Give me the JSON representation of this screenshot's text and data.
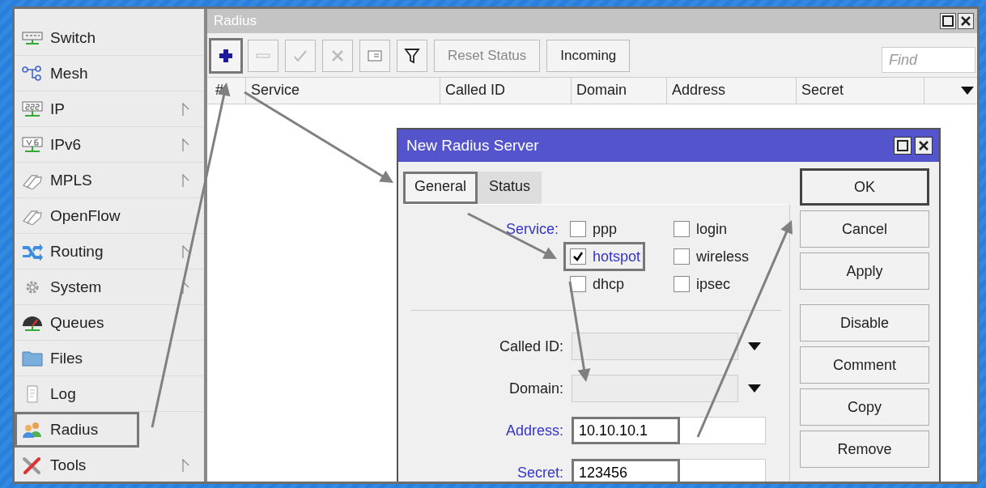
{
  "sidebar": {
    "items": [
      {
        "label": "Switch",
        "submenu": false,
        "highlighted": false
      },
      {
        "label": "Mesh",
        "submenu": false,
        "highlighted": false
      },
      {
        "label": "IP",
        "submenu": true,
        "highlighted": false
      },
      {
        "label": "IPv6",
        "submenu": true,
        "highlighted": false
      },
      {
        "label": "MPLS",
        "submenu": true,
        "highlighted": false
      },
      {
        "label": "OpenFlow",
        "submenu": false,
        "highlighted": false
      },
      {
        "label": "Routing",
        "submenu": true,
        "highlighted": false
      },
      {
        "label": "System",
        "submenu": true,
        "highlighted": false
      },
      {
        "label": "Queues",
        "submenu": false,
        "highlighted": false
      },
      {
        "label": "Files",
        "submenu": false,
        "highlighted": false
      },
      {
        "label": "Log",
        "submenu": false,
        "highlighted": false
      },
      {
        "label": "Radius",
        "submenu": false,
        "highlighted": true
      },
      {
        "label": "Tools",
        "submenu": true,
        "highlighted": false
      }
    ]
  },
  "radius_window": {
    "title": "Radius",
    "toolbar": [
      {
        "kind": "add",
        "disabled": false,
        "highlighted": true
      },
      {
        "kind": "remove",
        "disabled": true,
        "highlighted": false
      },
      {
        "kind": "enable",
        "disabled": true,
        "highlighted": false
      },
      {
        "kind": "disable",
        "disabled": true,
        "highlighted": false
      },
      {
        "kind": "comment",
        "disabled": false,
        "highlighted": false
      },
      {
        "kind": "filter",
        "disabled": false,
        "highlighted": false
      },
      {
        "kind": "text",
        "label": "Reset Status",
        "disabled": true,
        "highlighted": false
      },
      {
        "kind": "text",
        "label": "Incoming",
        "disabled": false,
        "highlighted": false
      }
    ],
    "find": {
      "placeholder": "Find"
    },
    "table": {
      "columns": [
        "#",
        "Service",
        "Called ID",
        "Domain",
        "Address",
        "Secret"
      ]
    }
  },
  "dialog": {
    "title": "New Radius Server",
    "tabs": [
      {
        "label": "General",
        "selected": true,
        "highlighted": true
      },
      {
        "label": "Status",
        "selected": false,
        "highlighted": false
      }
    ],
    "service": {
      "label": "Service:",
      "modified": true,
      "options": [
        {
          "label": "ppp",
          "checked": false,
          "highlighted": false
        },
        {
          "label": "login",
          "checked": false,
          "highlighted": false
        },
        {
          "label": "hotspot",
          "checked": true,
          "highlighted": true
        },
        {
          "label": "wireless",
          "checked": false,
          "highlighted": false
        },
        {
          "label": "dhcp",
          "checked": false,
          "highlighted": false
        },
        {
          "label": "ipsec",
          "checked": false,
          "highlighted": false
        }
      ]
    },
    "fields": [
      {
        "kind": "dropdown",
        "label": "Called ID:",
        "modified": false,
        "highlighted": false
      },
      {
        "kind": "dropdown",
        "label": "Domain:",
        "modified": false,
        "highlighted": false
      },
      {
        "kind": "input",
        "label": "Address:",
        "value": "10.10.10.1",
        "modified": true,
        "highlighted": true
      },
      {
        "kind": "input",
        "label": "Secret:",
        "value": "123456",
        "modified": true,
        "highlighted": true
      }
    ],
    "buttons": [
      {
        "label": "OK",
        "default": true
      },
      {
        "label": "Cancel",
        "default": false
      },
      {
        "label": "Apply",
        "default": false
      },
      {
        "label": "Disable",
        "default": false
      },
      {
        "label": "Comment",
        "default": false
      },
      {
        "label": "Copy",
        "default": false
      },
      {
        "label": "Remove",
        "default": false
      }
    ]
  }
}
